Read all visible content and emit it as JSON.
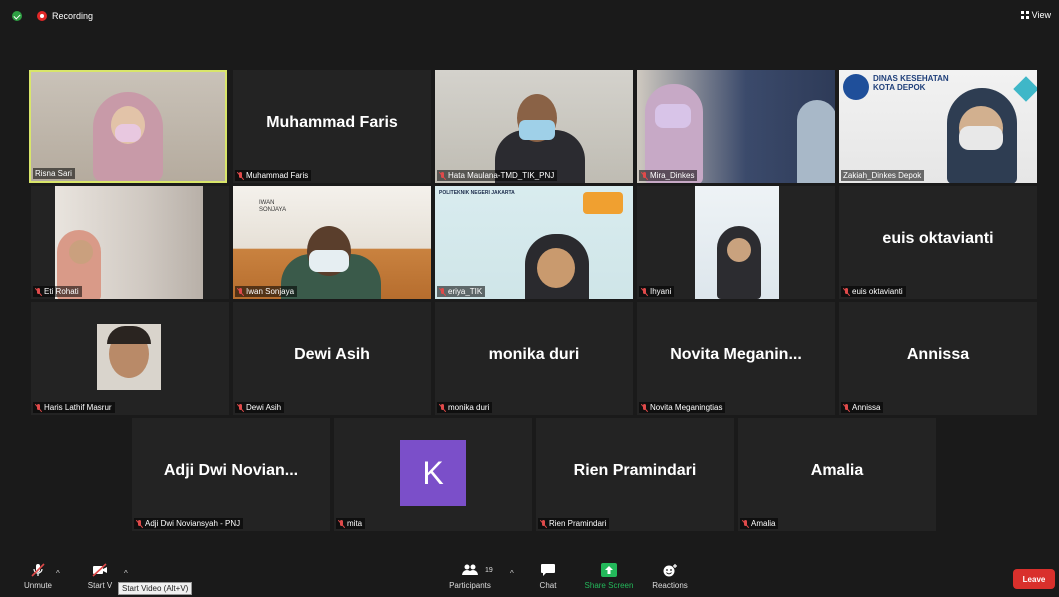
{
  "topbar": {
    "recording_label": "Recording",
    "view_label": "View"
  },
  "participants": [
    {
      "name": "Risna Sari",
      "big": "",
      "type": "video",
      "active": true
    },
    {
      "name": "Muhammad Faris",
      "big": "Muhammad Faris",
      "type": "name"
    },
    {
      "name": "Hata Maulana-TMD_TIK_PNJ",
      "big": "",
      "type": "video"
    },
    {
      "name": "Mira_Dinkes",
      "big": "",
      "type": "video"
    },
    {
      "name": "Zakiah_Dinkes Depok",
      "big": "",
      "type": "video",
      "overlay": "DINAS KESEHATAN KOTA DEPOK"
    },
    {
      "name": "Eti Rohati",
      "big": "",
      "type": "video"
    },
    {
      "name": "Iwan Sonjaya",
      "big": "",
      "type": "video",
      "overlay": "IWAN SONJAYA"
    },
    {
      "name": "eriya_TIK",
      "big": "",
      "type": "video",
      "overlay": "POLITEKNIK NEGERI JAKARTA"
    },
    {
      "name": "Ihyani",
      "big": "",
      "type": "video"
    },
    {
      "name": "euis oktavianti",
      "big": "euis oktavianti",
      "type": "name"
    },
    {
      "name": "Haris Lathif Masrur",
      "big": "",
      "type": "video"
    },
    {
      "name": "Dewi Asih",
      "big": "Dewi Asih",
      "type": "name"
    },
    {
      "name": "monika duri",
      "big": "monika duri",
      "type": "name"
    },
    {
      "name": "Novita Meganingtias",
      "big": "Novita  Meganin...",
      "type": "name"
    },
    {
      "name": "Annissa",
      "big": "Annissa",
      "type": "name"
    },
    {
      "name": "Adji Dwi Noviansyah - PNJ",
      "big": "Adji  Dwi  Novian...",
      "type": "name"
    },
    {
      "name": "mita",
      "big": "",
      "type": "avatar",
      "initial": "K"
    },
    {
      "name": "Rien Pramindari",
      "big": "Rien Pramindari",
      "type": "name"
    },
    {
      "name": "Amalia",
      "big": "Amalia",
      "type": "name"
    }
  ],
  "toolbar": {
    "unmute": "Unmute",
    "start_video": "Start V",
    "tooltip": "Start Video (Alt+V)",
    "participants": "Participants",
    "participant_count": "19",
    "chat": "Chat",
    "share": "Share Screen",
    "reactions": "Reactions",
    "leave": "Leave"
  },
  "colors": {
    "active_border": "#d9e66a",
    "leave": "#d9302c",
    "share": "#23b85a",
    "avatar": "#7b4fc9"
  }
}
